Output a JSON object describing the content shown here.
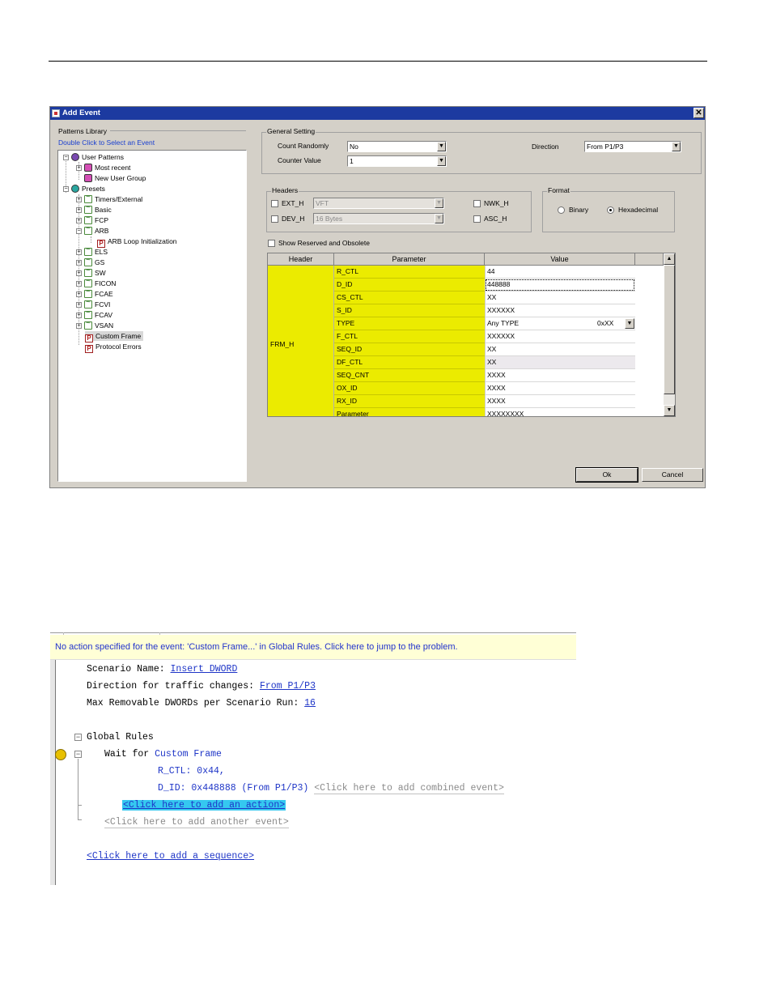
{
  "dialog": {
    "title": "Add Event",
    "close_glyph": "✕",
    "patterns_library": {
      "label": "Patterns Library",
      "hint": "Double Click to Select an Event",
      "tree": [
        {
          "label": "User Patterns"
        },
        {
          "label": "Most recent"
        },
        {
          "label": "New User Group"
        },
        {
          "label": "Presets"
        },
        {
          "label": "Timers/External"
        },
        {
          "label": "Basic"
        },
        {
          "label": "FCP"
        },
        {
          "label": "ARB"
        },
        {
          "label": "ARB Loop Initialization"
        },
        {
          "label": "ELS"
        },
        {
          "label": "GS"
        },
        {
          "label": "SW"
        },
        {
          "label": "FICON"
        },
        {
          "label": "FCAE"
        },
        {
          "label": "FCVI"
        },
        {
          "label": "FCAV"
        },
        {
          "label": "VSAN"
        },
        {
          "label": "Custom Frame"
        },
        {
          "label": "Protocol Errors"
        }
      ]
    },
    "general_setting": {
      "title": "General Setting",
      "count_randomly_label": "Count Randomly",
      "count_randomly_value": "No",
      "counter_value_label": "Counter Value",
      "counter_value": "1",
      "direction_label": "Direction",
      "direction_value": "From P1/P3"
    },
    "headers": {
      "title": "Headers",
      "ext_h": "EXT_H",
      "ext_value": "VFT",
      "dev_h": "DEV_H",
      "dev_value": "16 Bytes",
      "nwk_h": "NWK_H",
      "asc_h": "ASC_H"
    },
    "format": {
      "title": "Format",
      "binary": "Binary",
      "hexadecimal": "Hexadecimal",
      "selected": "Hexadecimal"
    },
    "show_reserved_label": "Show Reserved and Obsolete",
    "grid": {
      "columns": [
        "Header",
        "Parameter",
        "Value"
      ],
      "header_name": "FRM_H",
      "rows": [
        {
          "parameter": "R_CTL",
          "value": "44"
        },
        {
          "parameter": "D_ID",
          "value": "448888"
        },
        {
          "parameter": "CS_CTL",
          "value": "XX"
        },
        {
          "parameter": "S_ID",
          "value": "XXXXXX"
        },
        {
          "parameter": "TYPE",
          "value": "Any TYPE",
          "value_extra": "0xXX"
        },
        {
          "parameter": "F_CTL",
          "value": "XXXXXX"
        },
        {
          "parameter": "SEQ_ID",
          "value": "XX"
        },
        {
          "parameter": "DF_CTL",
          "value": "XX"
        },
        {
          "parameter": "SEQ_CNT",
          "value": "XXXX"
        },
        {
          "parameter": "OX_ID",
          "value": "XXXX"
        },
        {
          "parameter": "RX_ID",
          "value": "XXXX"
        },
        {
          "parameter": "Parameter",
          "value": "XXXXXXXX"
        }
      ]
    },
    "ok_label": "Ok",
    "cancel_label": "Cancel"
  },
  "editor": {
    "warning": "No action specified for the event: 'Custom Frame...' in Global Rules.  Click here to jump to the problem.",
    "scenario_name_label": "Scenario Name:",
    "scenario_name_value": "Insert DWORD",
    "direction_label": "Direction for traffic changes:",
    "direction_value": "From P1/P3",
    "max_label": "Max Removable DWORDs per Scenario Run:",
    "max_value": "16",
    "global_rules": "Global Rules",
    "wait_for": "Wait for",
    "wait_target": "Custom Frame",
    "r_ctl_line": "R_CTL: 0x44,",
    "d_id_line": "D_ID: 0x448888 (From P1/P3)",
    "add_combined": "<Click here to add combined event>",
    "add_action": "<Click here to add an action>",
    "add_another_event": "<Click here to add another event>",
    "add_sequence": "<Click here to add a sequence>"
  }
}
